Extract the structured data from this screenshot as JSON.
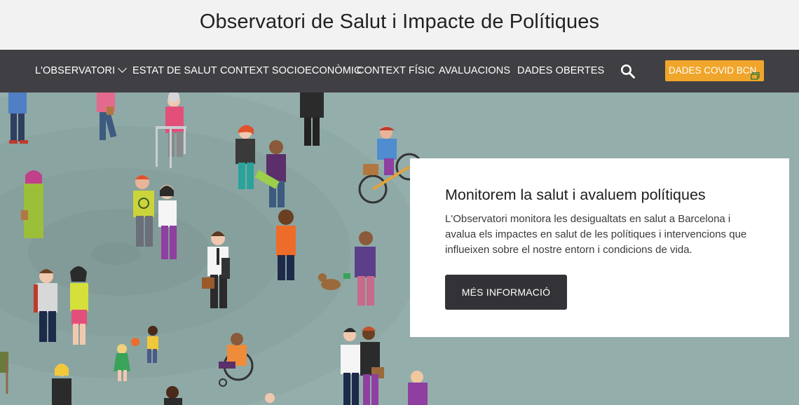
{
  "header": {
    "title": "Observatori de Salut i Impacte de Polítiques"
  },
  "nav": {
    "items": [
      {
        "label": "L'OBSERVATORI"
      },
      {
        "label": "ESTAT DE SALUT"
      },
      {
        "label": "CONTEXT SOCIOECONÒMIC"
      },
      {
        "label": "CONTEXT FÍSIC"
      },
      {
        "label": "AVALUACIONS"
      },
      {
        "label": "DADES OBERTES"
      }
    ],
    "search_icon": "search-icon",
    "covid_button": "DADES COVID BCN"
  },
  "hero": {
    "title": "Monitorem la salut i avaluem polítiques",
    "text": "L'Observatori monitora les desigualtats en salut a Barcelona i avalua els impactes en salut de les polítiques i intervencions que influeixen sobre el nostre entorn i condicions de vida.",
    "button_label": "MÉS INFORMACIÓ"
  },
  "colors": {
    "header_bg": "#f2f2f2",
    "nav_bg": "#403f44",
    "accent": "#f0a52b",
    "hero_bg": "#94aeab",
    "button_dark": "#333237"
  }
}
